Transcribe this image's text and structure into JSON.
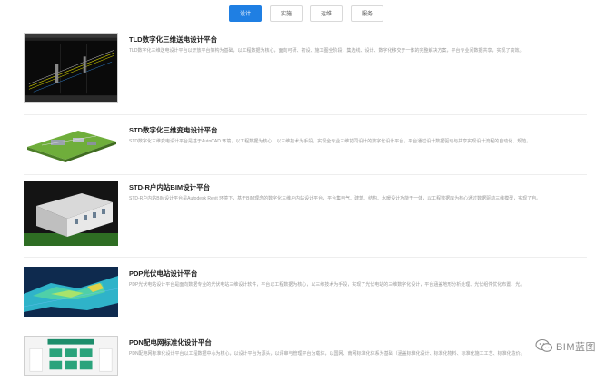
{
  "tabs": [
    {
      "label": "设计",
      "active": true
    },
    {
      "label": "实施",
      "active": false
    },
    {
      "label": "运维",
      "active": false
    },
    {
      "label": "服务",
      "active": false
    }
  ],
  "platforms": [
    {
      "title": "TLD数字化三维送电设计平台",
      "description": "TLD数字化三维送电设计平台以开放平台架构为基础，以工程数据为核心，面向可研、初设、施工图全阶段，集选线、设计、数字化移交于一体的完整解决方案，平台专业间数据共享，实现了高效。",
      "thumbnail_icon": "cad-transmission-line-thumbnail"
    },
    {
      "title": "STD数字化三维变电设计平台",
      "description": "STD数字化三维变电设计平台是基于AutoCAD 环境，以工程数据为核心，以三维技术为手段，实现全专业三维协同设计的数字化设计平台，平台通过设计数据驱动与共享实现设计流程的自动化、规范。",
      "thumbnail_icon": "substation-model-thumbnail"
    },
    {
      "title": "STD-R户内站BIM设计平台",
      "description": "STD-R户内站BIM设计平台是Autodesk Revit 环境下，基于BIM理念的数字化三维户内站设计平台，平台集电气、建筑、结构、水暖设计功能于一体，以工程数据库为核心通过数据驱动三维模型，实现了自。",
      "thumbnail_icon": "indoor-substation-building-thumbnail"
    },
    {
      "title": "PDP光伏电站设计平台",
      "description": "PDP光伏电站设计平台是面向数据专业的光伏电站三维设计软件，平台以工程数据为核心，以三维技术为手段，实现了光伏电站的三维数字化设计，平台涵盖地形分析处理、光伏组件优化布置、光。",
      "thumbnail_icon": "terrain-analysis-thumbnail"
    },
    {
      "title": "PDN配电网标准化设计平台",
      "description": "PDN配电网标准化设计平台以工程数据中心为核心，以设计平台为源头，以评审与管理平台为载体，以国网、南网标准化体系为基础（涵盖标准化设计、标准化物料、标准化施工工艺、标准化造价。",
      "thumbnail_icon": "distribution-network-ui-thumbnail"
    }
  ],
  "watermark": {
    "text": "BIM蓝图",
    "icon": "wechat-icon"
  },
  "colors": {
    "accent": "#1f7fe3",
    "title": "#222222",
    "description": "#9a9a9a"
  }
}
